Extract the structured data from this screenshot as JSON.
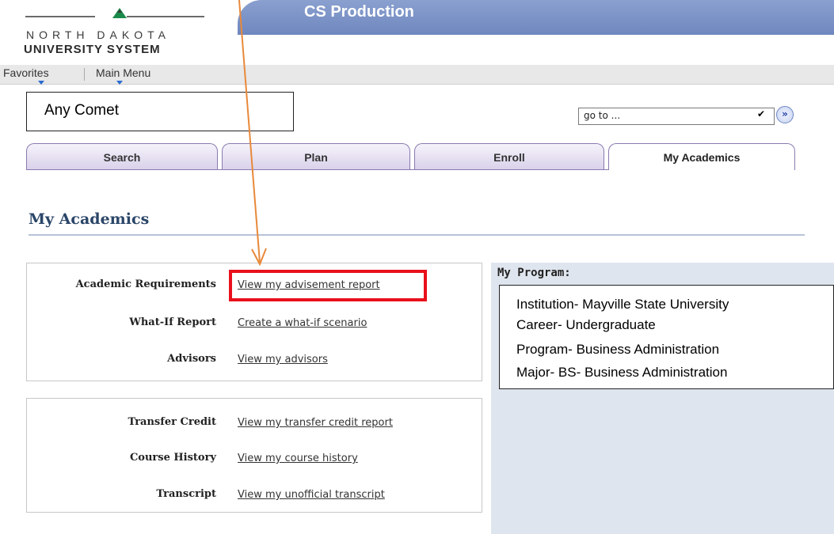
{
  "header": {
    "logo_top": "NORTH DAKOTA",
    "logo_bottom": "UNIVERSITY SYSTEM",
    "banner_title": "CS Production"
  },
  "menu": {
    "favorites": "Favorites",
    "main_menu": "Main Menu"
  },
  "student_name": "Any Comet",
  "goto": {
    "value": "go to ...",
    "arrow": "✔",
    "button_glyph": "»"
  },
  "tabs": [
    {
      "label": "Search",
      "active": false
    },
    {
      "label": "Plan",
      "active": false
    },
    {
      "label": "Enroll",
      "active": false
    },
    {
      "label": "My Academics",
      "active": true
    }
  ],
  "page_title": "My Academics",
  "academic_panel": {
    "rows": [
      {
        "label": "Academic Requirements",
        "link": "View my advisement report"
      },
      {
        "label": "What-If Report",
        "link": "Create a what-if scenario"
      },
      {
        "label": "Advisors",
        "link": "View my advisors"
      }
    ]
  },
  "records_panel": {
    "rows": [
      {
        "label": "Transfer Credit",
        "link": "View my transfer credit report"
      },
      {
        "label": "Course History",
        "link": "View my course history"
      },
      {
        "label": "Transcript",
        "link": "View my unofficial transcript"
      }
    ]
  },
  "program": {
    "heading": "My Program:",
    "lines": [
      "Institution- Mayville State University",
      "Career- Undergraduate",
      "Program- Business Administration",
      "Major- BS- Business Administration"
    ]
  },
  "annotation": {
    "arrow_color": "#e8893a",
    "highlight_color": "#e8101a"
  }
}
